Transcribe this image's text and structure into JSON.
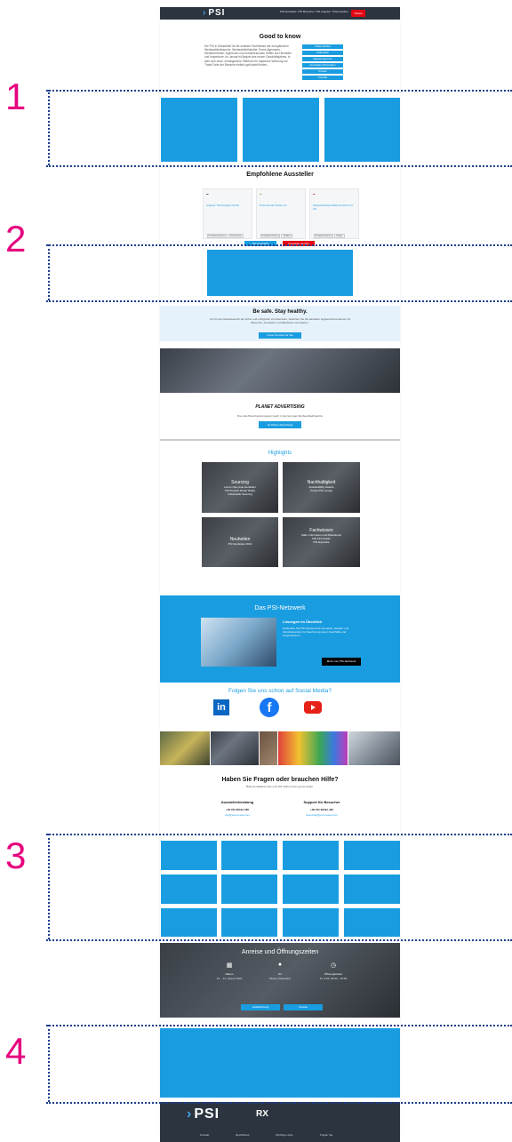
{
  "header": {
    "logo_text": "PSI",
    "nav": [
      "PSI Aussteller",
      "PSI Besucher",
      "PSI Angebot",
      "Ticket kaufen"
    ],
    "cta": "Tickets"
  },
  "good_to_know": {
    "title": "Good to know",
    "text": "Die PSI in Düsseldorf ist die zentrale Fachmesse der europäischen Werbeartikelbranche. Werbeartikelhändler, Event-Agenturen, Werbetechniker, Agenturen und Industriekunden treffen auf Hersteller und Importeure. Im Januar ist Beginn des neuen Geschäftsjahres, in dem sich neue, umfangreiche Plattform für haptische Werbung zur Trade-Fairs der Branche einfach gebündelt finden...",
    "links": [
      "Ticket kaufen",
      "Hallenplan",
      "Tagesprogramm",
      "Aussteller-Information",
      "Presse",
      "Kontakt"
    ]
  },
  "featured": {
    "title": "Empfohlene Aussteller",
    "cards": [
      {
        "name": "Angerer Technologie GmbH",
        "tags": [
          "Produktsortiment",
          "Werbemittel"
        ]
      },
      {
        "name": "Promotional Textile Ltd",
        "tags": [
          "Produktsortiment",
          "Textilien"
        ]
      },
      {
        "name": "Papierdruckspezialist GmbH & Co KG",
        "tags": [
          "Produktsortiment",
          "Papier"
        ]
      }
    ],
    "buttons": [
      "Alle Aussteller",
      "Aussteller werden"
    ]
  },
  "safe": {
    "title": "Be safe. Stay healthy.",
    "text": "Um für den Messebesuch als sicher und erfolgreich vorzubereiten, beachten Sie die aktuellen Hygieneinformationen für Besucher, Aussteller und Mitarbeiter einzusehen.",
    "button": "Unser Konzept für Sie"
  },
  "planet": {
    "logo": "PLANET ADVERTISING",
    "text": "Die volle Branchenkompetenz auch in der Europas Werbeartikelbranche",
    "button": "Zu Planet Advertising"
  },
  "highlights": {
    "title": "Highlights",
    "tiles": [
      {
        "title": "Sourcing",
        "lines": [
          "Lernen Sie neue Hersteller",
          "PSI Product Finder Pfade",
          "Individuelle Sourcing"
        ]
      },
      {
        "title": "Nachhaltigkeit",
        "lines": [
          "Sustainability Awards",
          "Textile PSI Lounge"
        ]
      },
      {
        "title": "Neuheiten",
        "lines": [
          "PSI Neuheiten 2021"
        ]
      },
      {
        "title": "Fachwissen",
        "lines": [
          "Talks: Informieren und Diskutieren",
          "PSI First Guide",
          "PSI Expertise"
        ]
      }
    ]
  },
  "network": {
    "title": "Das PSI-Netzwerk",
    "subtitle": "Lösungen im Überblick",
    "text": "Entdecken Sie PSI Netzwerk für Hersteller, Händler und Industriekunden zur Gewinnung neuer Geschäfte und Kooperationen.",
    "button": "Mehr zum PSI-Netzwerk"
  },
  "social": {
    "title": "Folgen Sie uns schon auf Social Media?",
    "icons": [
      "linkedin-icon",
      "facebook-icon",
      "youtube-icon"
    ]
  },
  "help": {
    "title": "Haben Sie Fragen oder brauchen Hilfe?",
    "subtitle": "Bitte kontaktieren Sie uns! Wir helfen Ihnen gerne weiter.",
    "col1_title": "Ausstellerberatung",
    "col1_phone": "+49 211 90191-780",
    "col1_mail": "info@psi-messe.com",
    "col2_title": "Support für Besucher",
    "col2_phone": "+49 211 90191-440",
    "col2_mail": "besucher@psi-messe.com"
  },
  "travel": {
    "title": "Anreise und Öffnungszeiten",
    "col1_label": "Datum",
    "col1_val": "12. - 14. Januar 2022",
    "col2_label": "Ort",
    "col2_val": "Messe Düsseldorf",
    "col3_label": "Öffnungszeiten",
    "col3_val": "Di. & Mi. 09:00 – 18:00",
    "buttons": [
      "Hotelbuchung",
      "Anreise"
    ]
  },
  "footer": {
    "logo_text": "PSI",
    "rx": "RX",
    "cols": [
      "Kontakt",
      "Rechtliches",
      "Wichtige Links",
      "Folgen Sie"
    ]
  },
  "markers": [
    "1",
    "2",
    "3",
    "4"
  ],
  "colors": {
    "accent": "#1a9de0",
    "marker": "#e6007e",
    "dots": "#1a3d8f",
    "dark": "#2c3440"
  }
}
